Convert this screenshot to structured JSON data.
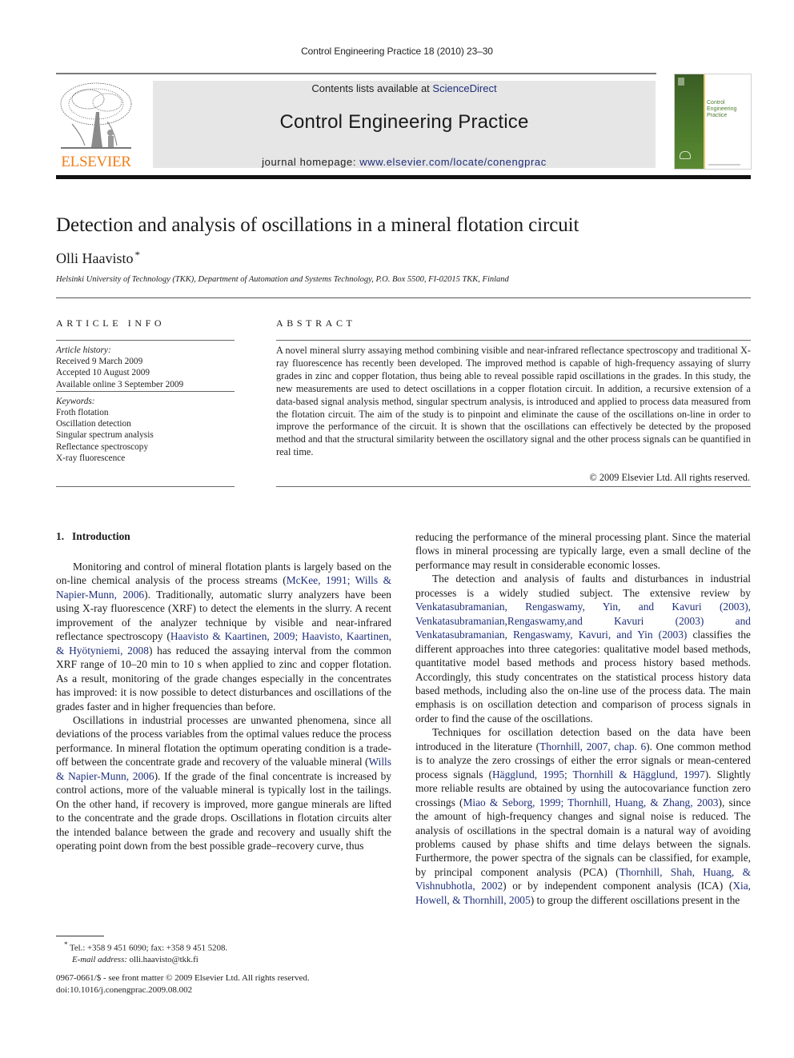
{
  "running_head": "Control Engineering Practice 18 (2010) 23–30",
  "publisher": {
    "logo_word": "ELSEVIER",
    "logo_color": "#f07f1b"
  },
  "banner": {
    "contents_prefix": "Contents lists available at ",
    "contents_link": "ScienceDirect",
    "journal_title": "Control Engineering Practice",
    "homepage_prefix": "journal homepage: ",
    "homepage_link": "www.elsevier.com/locate/conengprac"
  },
  "cover": {
    "title_lines": [
      "Control",
      "Engineering",
      "Practice"
    ],
    "spine_color": "#4c7a2c"
  },
  "article": {
    "title": "Detection and analysis of oscillations in a mineral flotation circuit",
    "author": "Olli Haavisto",
    "author_mark": "*",
    "affiliation": "Helsinki University of Technology (TKK), Department of Automation and Systems Technology, P.O. Box 5500, FI-02015 TKK, Finland"
  },
  "article_info": {
    "heading": "ARTICLE INFO",
    "history_label": "Article history:",
    "history": [
      "Received 9 March 2009",
      "Accepted 10 August 2009",
      "Available online 3 September 2009"
    ],
    "keywords_label": "Keywords:",
    "keywords": [
      "Froth flotation",
      "Oscillation detection",
      "Singular spectrum analysis",
      "Reflectance spectroscopy",
      "X-ray fluorescence"
    ]
  },
  "abstract": {
    "heading": "ABSTRACT",
    "text": "A novel mineral slurry assaying method combining visible and near-infrared reflectance spectroscopy and traditional X-ray fluorescence has recently been developed. The improved method is capable of high-frequency assaying of slurry grades in zinc and copper flotation, thus being able to reveal possible rapid oscillations in the grades. In this study, the new measurements are used to detect oscillations in a copper flotation circuit. In addition, a recursive extension of a data-based signal analysis method, singular spectrum analysis, is introduced and applied to process data measured from the flotation circuit. The aim of the study is to pinpoint and eliminate the cause of the oscillations on-line in order to improve the performance of the circuit. It is shown that the oscillations can effectively be detected by the proposed method and that the structural similarity between the oscillatory signal and the other process signals can be quantified in real time.",
    "copyright": "© 2009 Elsevier Ltd. All rights reserved."
  },
  "section1": {
    "number": "1.",
    "title": "Introduction"
  },
  "body_left": {
    "p1": [
      {
        "t": "Monitoring and control of mineral flotation plants is largely based on the on-line chemical analysis of the process streams ("
      },
      {
        "l": "McKee, 1991; Wills & Napier-Munn, 2006"
      },
      {
        "t": "). Traditionally, automatic slurry analyzers have been using X-ray fluorescence (XRF) to detect the elements in the slurry. A recent improvement of the analyzer technique by visible and near-infrared reflectance spectroscopy ("
      },
      {
        "l": "Haavisto & Kaartinen, 2009; Haavisto, Kaartinen, & Hyötyniemi, 2008"
      },
      {
        "t": ") has reduced the assaying interval from the common XRF range of 10–20 min to 10 s when applied to zinc and copper flotation. As a result, monitoring of the grade changes especially in the concentrates has improved: it is now possible to detect disturbances and oscillations of the grades faster and in higher frequencies than before."
      }
    ],
    "p2": [
      {
        "t": "Oscillations in industrial processes are unwanted phenomena, since all deviations of the process variables from the optimal values reduce the process performance. In mineral flotation the optimum operating condition is a trade-off between the concentrate grade and recovery of the valuable mineral ("
      },
      {
        "l": "Wills & Napier-Munn, 2006"
      },
      {
        "t": "). If the grade of the final concentrate is increased by control actions, more of the valuable mineral is typically lost in the tailings. On the other hand, if recovery is improved, more gangue minerals are lifted to the concentrate and the grade drops. Oscillations in flotation circuits alter the intended balance between the grade and recovery and usually shift the operating point down from the best possible grade–recovery curve, thus"
      }
    ]
  },
  "body_right": {
    "p0": [
      {
        "t": "reducing the performance of the mineral processing plant. Since the material flows in mineral processing are typically large, even a small decline of the performance may result in considerable economic losses."
      }
    ],
    "p1": [
      {
        "t": "The detection and analysis of faults and disturbances in industrial processes is a widely studied subject. The extensive review by "
      },
      {
        "l": "Venkatasubramanian, Rengaswamy, Yin, and Kavuri (2003), Venkatasubramanian,Rengaswamy,and Kavuri (2003) and Venkatasubramanian, Rengaswamy, Kavuri, and Yin (2003)"
      },
      {
        "t": " classifies the different approaches into three categories: qualitative model based methods, quantitative model based methods and process history based methods. Accordingly, this study concentrates on the statistical process history data based methods, including also the on-line use of the process data. The main emphasis is on oscillation detection and comparison of process signals in order to find the cause of the oscillations."
      }
    ],
    "p2": [
      {
        "t": "Techniques for oscillation detection based on the data have been introduced in the literature ("
      },
      {
        "l": "Thornhill, 2007, chap. 6"
      },
      {
        "t": "). One common method is to analyze the zero crossings of either the error signals or mean-centered process signals ("
      },
      {
        "l": "Hägglund, 1995; Thornhill & Hägglund, 1997"
      },
      {
        "t": "). Slightly more reliable results are obtained by using the autocovariance function zero crossings ("
      },
      {
        "l": "Miao & Seborg, 1999; Thornhill, Huang, & Zhang, 2003"
      },
      {
        "t": "), since the amount of high-frequency changes and signal noise is reduced. The analysis of oscillations in the spectral domain is a natural way of avoiding problems caused by phase shifts and time delays between the signals. Furthermore, the power spectra of the signals can be classified, for example, by principal component analysis (PCA) ("
      },
      {
        "l": "Thornhill, Shah, Huang, & Vishnubhotla, 2002"
      },
      {
        "t": ") or by independent component analysis (ICA) ("
      },
      {
        "l": "Xia, Howell, & Thornhill, 2005"
      },
      {
        "t": ") to group the different oscillations present in the"
      }
    ]
  },
  "footnote": {
    "mark": "*",
    "contact": "Tel.: +358 9 451 6090; fax: +358 9 451 5208.",
    "email_label": "E-mail address:",
    "email": "olli.haavisto@tkk.fi"
  },
  "front_matter": {
    "issn_line": "0967-0661/$ - see front matter © 2009 Elsevier Ltd. All rights reserved.",
    "doi": "doi:10.1016/j.conengprac.2009.08.002"
  },
  "colors": {
    "link": "#1f2f7a",
    "banner_bg": "#e6e6e6"
  }
}
